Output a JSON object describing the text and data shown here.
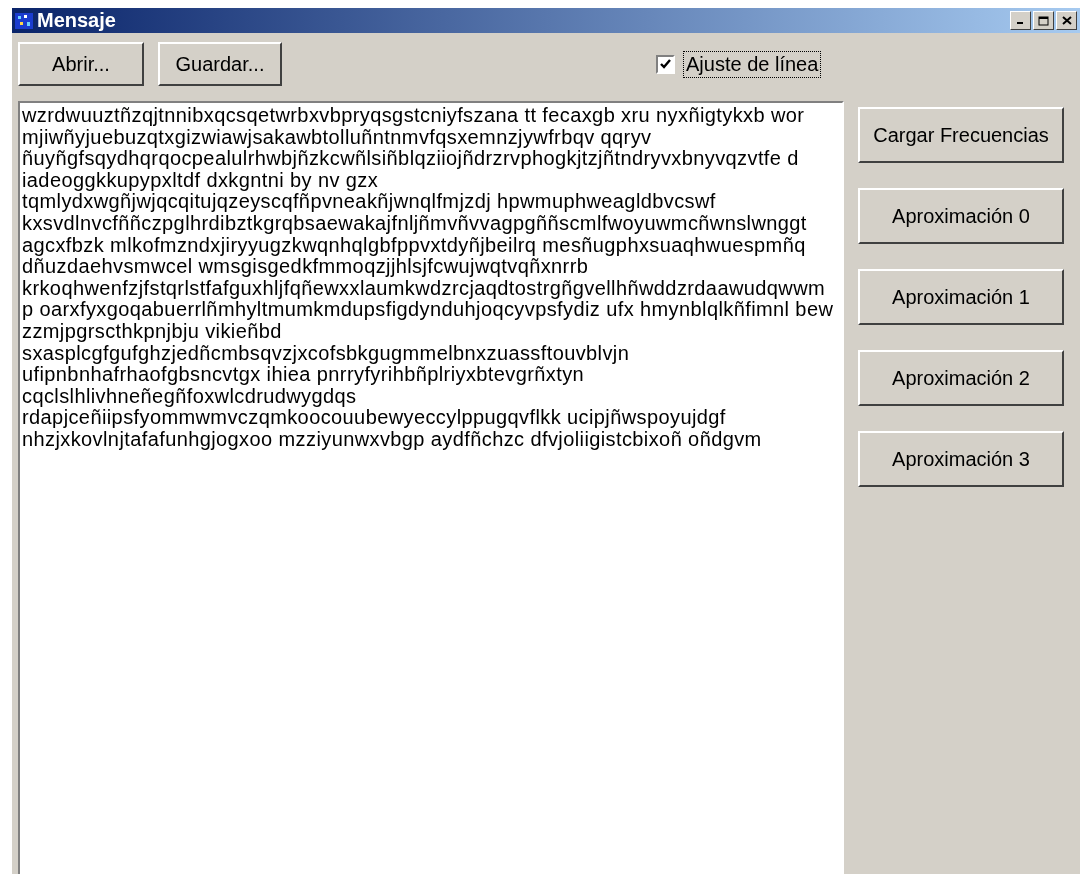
{
  "window": {
    "title": "Mensaje"
  },
  "toolbar": {
    "buttons": [
      "Abrir...",
      "Guardar..."
    ],
    "word_wrap": {
      "label": "Ajuste de línea",
      "checked": true
    }
  },
  "text_area": {
    "lines": [
      "wzrdwuuztñzqjtnnibxqcsqetwrbxvbpryqsgstcniyfszana tt fecaxgb xru nyxñigtykxb wor",
      "mjiwñyjuebuzqtxgizwiawjsakawbtolluñntnmvfqsxemnzjywfrbqv qqryv",
      "ñuyñgfsqydhqrqocpealulrhwbjñzkcwñlsiñblqziiojñdrzrvphogkjtzjñtndryvxbnyvqzvtfe d",
      "iadeoggkkupypxltdf dxkgntni by nv gzx",
      "tqmlydxwgñjwjqcqitujqzeyscqfñpvneakñjwnqlfmjzdj hpwmuphweagldbvcswf",
      "kxsvdlnvcfññczpglhrdibztkgrqbsaewakajfnljñmvñvvagpgññscmlfwoyuwmcñwnslwnggt",
      "agcxfbzk mlkofmzndxjiryyugzkwqnhqlgbfppvxtdyñjbeilrq mesñugphxsuaqhwuespmñq",
      "dñuzdaehvsmwcel wmsgisgedkfmmoqzjjhlsjfcwujwqtvqñxnrrb",
      "krkoqhwenfzjfstqrlstfafguxhljfqñewxxlaumkwdzrcjaqdtostrgñgvellhñwddzrdaawudqwwm",
      "p oarxfyxgoqabuerrlñmhyltmumkmdupsfigdynduhjoqcyvpsfydiz ufx hmynblqlkñfimnl bew",
      "zzmjpgrscthkpnjbju vikieñbd",
      "sxasplcgfgufghzjedñcmbsqvzjxcofsbkgugmmelbnxzuassftouvblvjn",
      "ufipnbnhafrhaofgbsncvtgx ihiea pnrryfyrihbñplriyxbtevgrñxtyn",
      "cqclslhlivhneñegñfoxwlcdrudwygdqs",
      "rdapjceñiipsfyommwmvczqmkoocouubewyeccylppugqvflkk ucipjñwspoyujdgf",
      "nhzjxkovlnjtafafunhgjogxoo mzziyunwxvbgp aydfñchzc dfvjoliigistcbixoñ oñdgvm"
    ]
  },
  "side_buttons": [
    "Cargar Frecuencias",
    "Aproximación 0",
    "Aproximación 1",
    "Aproximación 2",
    "Aproximación 3"
  ]
}
